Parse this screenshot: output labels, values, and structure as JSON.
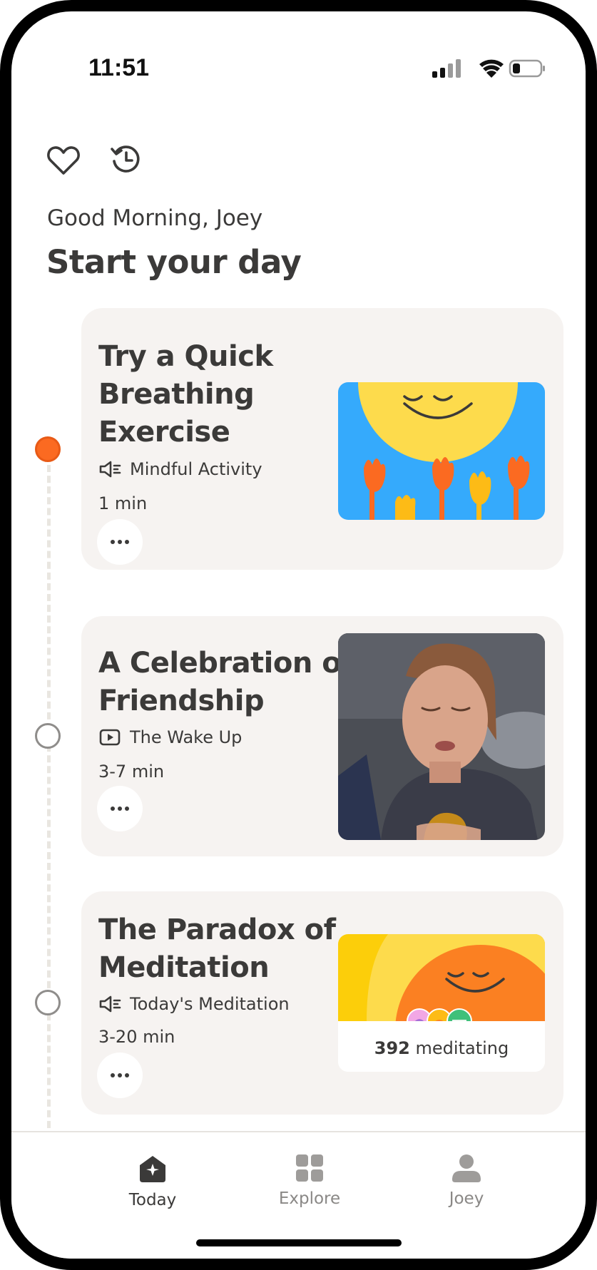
{
  "status": {
    "time": "11:51"
  },
  "header": {
    "greeting": "Good Morning, Joey",
    "headline": "Start your day",
    "icons": [
      "heart-icon",
      "history-icon"
    ]
  },
  "cards": [
    {
      "title_lines": [
        "Try a Quick",
        "Breathing",
        "Exercise"
      ],
      "category": "Mindful Activity",
      "category_icon": "audio-icon",
      "duration": "1 min",
      "active": true
    },
    {
      "title_lines": [
        "A Celebration of",
        "Friendship"
      ],
      "category": "The Wake Up",
      "category_icon": "video-icon",
      "duration": "3-7 min",
      "active": false
    },
    {
      "title_lines": [
        "The Paradox of",
        "Meditation"
      ],
      "category": "Today's Meditation",
      "category_icon": "audio-icon",
      "duration": "3-20 min",
      "meditating_count": "392",
      "meditating_label": "meditating",
      "active": false
    }
  ],
  "tabs": [
    {
      "label": "Today",
      "icon": "home-star-icon",
      "active": true
    },
    {
      "label": "Explore",
      "icon": "grid-icon",
      "active": false
    },
    {
      "label": "Joey",
      "icon": "person-icon",
      "active": false
    }
  ],
  "colors": {
    "accent_orange": "#fb6a21",
    "card_bg": "#f6f3f1",
    "sky_blue": "#35aafc",
    "sun_yellow": "#fddb4c",
    "text_dark": "#3b3a39"
  }
}
